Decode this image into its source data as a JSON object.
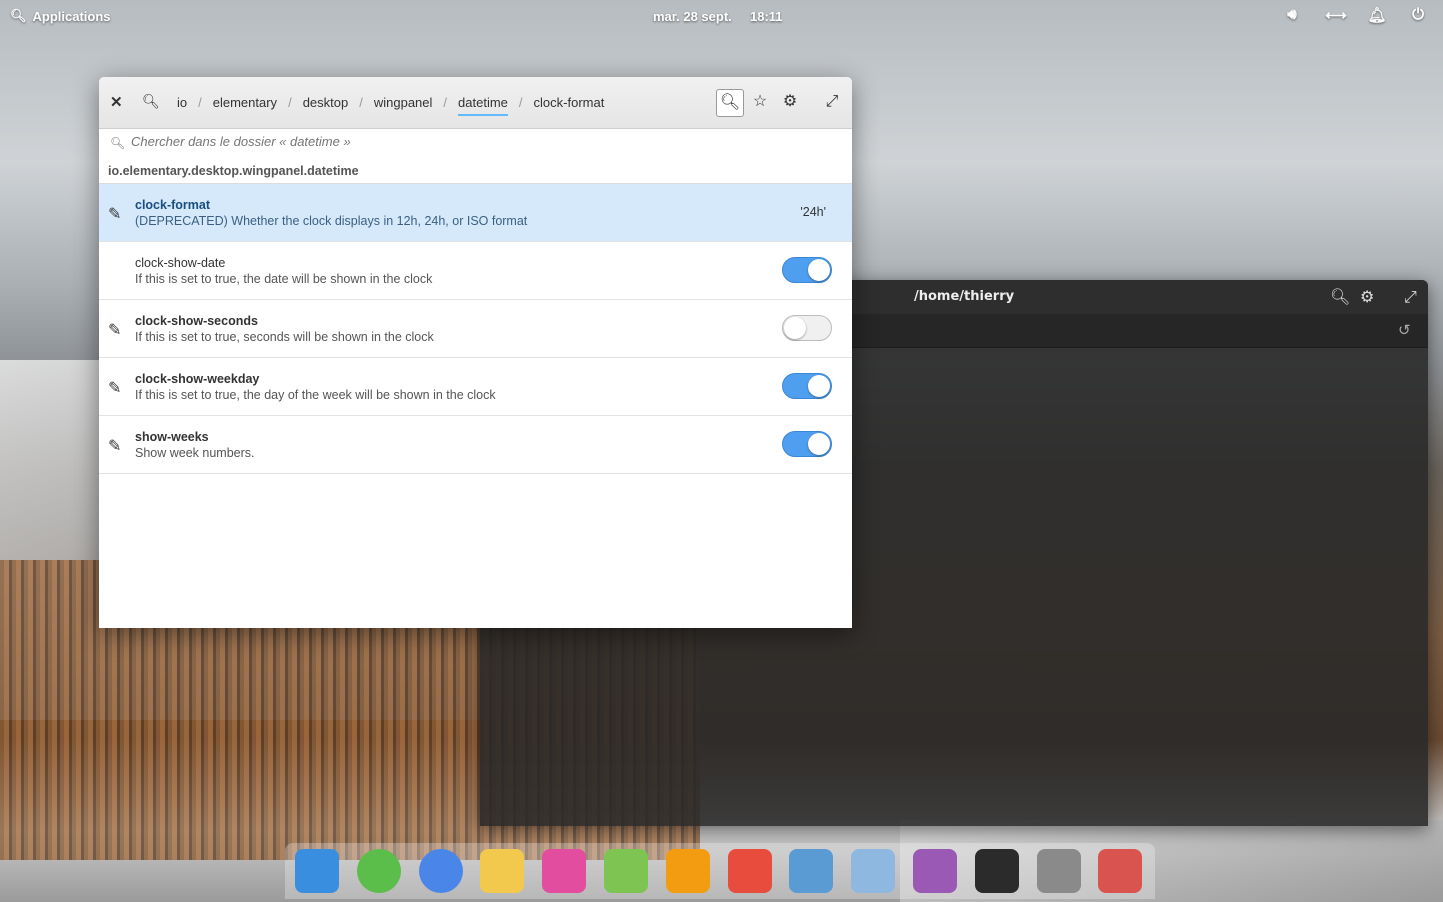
{
  "panel": {
    "applications": "Applications",
    "date": "mar. 28 sept.",
    "time": "18:11",
    "indicators": [
      "volume-icon",
      "network-icon",
      "notifications-icon",
      "power-icon"
    ]
  },
  "terminal": {
    "title": "/home/thierry"
  },
  "dconf": {
    "breadcrumbs": [
      "io",
      "elementary",
      "desktop",
      "wingpanel",
      "datetime",
      "clock-format"
    ],
    "active_crumb": "datetime",
    "search_placeholder": "Chercher dans le dossier « datetime »",
    "schema": "io.elementary.desktop.wingpanel.datetime",
    "keys": [
      {
        "name": "clock-format",
        "desc": "(DEPRECATED) Whether the clock displays in 12h, 24h, or ISO format",
        "value": "'24h'"
      },
      {
        "name": "clock-show-date",
        "desc": "If this is set to true, the date will be shown in the clock",
        "value": true
      },
      {
        "name": "clock-show-seconds",
        "desc": "If this is set to true, seconds will be shown in the clock",
        "value": false
      },
      {
        "name": "clock-show-weekday",
        "desc": "If this is set to true, the day of the week will be shown in the clock",
        "value": true
      },
      {
        "name": "show-weeks",
        "desc": "Show week numbers.",
        "value": true
      }
    ]
  },
  "dock": {
    "apps": [
      "multitasking-view-icon",
      "web-browser-icon",
      "chromium-icon",
      "mail-icon",
      "tasks-icon",
      "calendar-icon",
      "music-icon",
      "videos-icon",
      "photos-icon",
      "settings-icon",
      "appcenter-icon",
      "terminal-icon",
      "trash-icon",
      "todo-icon"
    ],
    "colors": [
      "#3a8ee0",
      "#5bbd4a",
      "#4a86e8",
      "#f2c94c",
      "#e34d9f",
      "#7dc453",
      "#f39c12",
      "#e74c3c",
      "#5a9bd4",
      "#8fb8e0",
      "#9b59b6",
      "#2b2b2b",
      "#8a8a8a",
      "#d9534f"
    ]
  },
  "colors": {
    "accent": "#64baff",
    "selected_row": "#d5e9fb",
    "toggle_on": "#4e9ff0"
  }
}
